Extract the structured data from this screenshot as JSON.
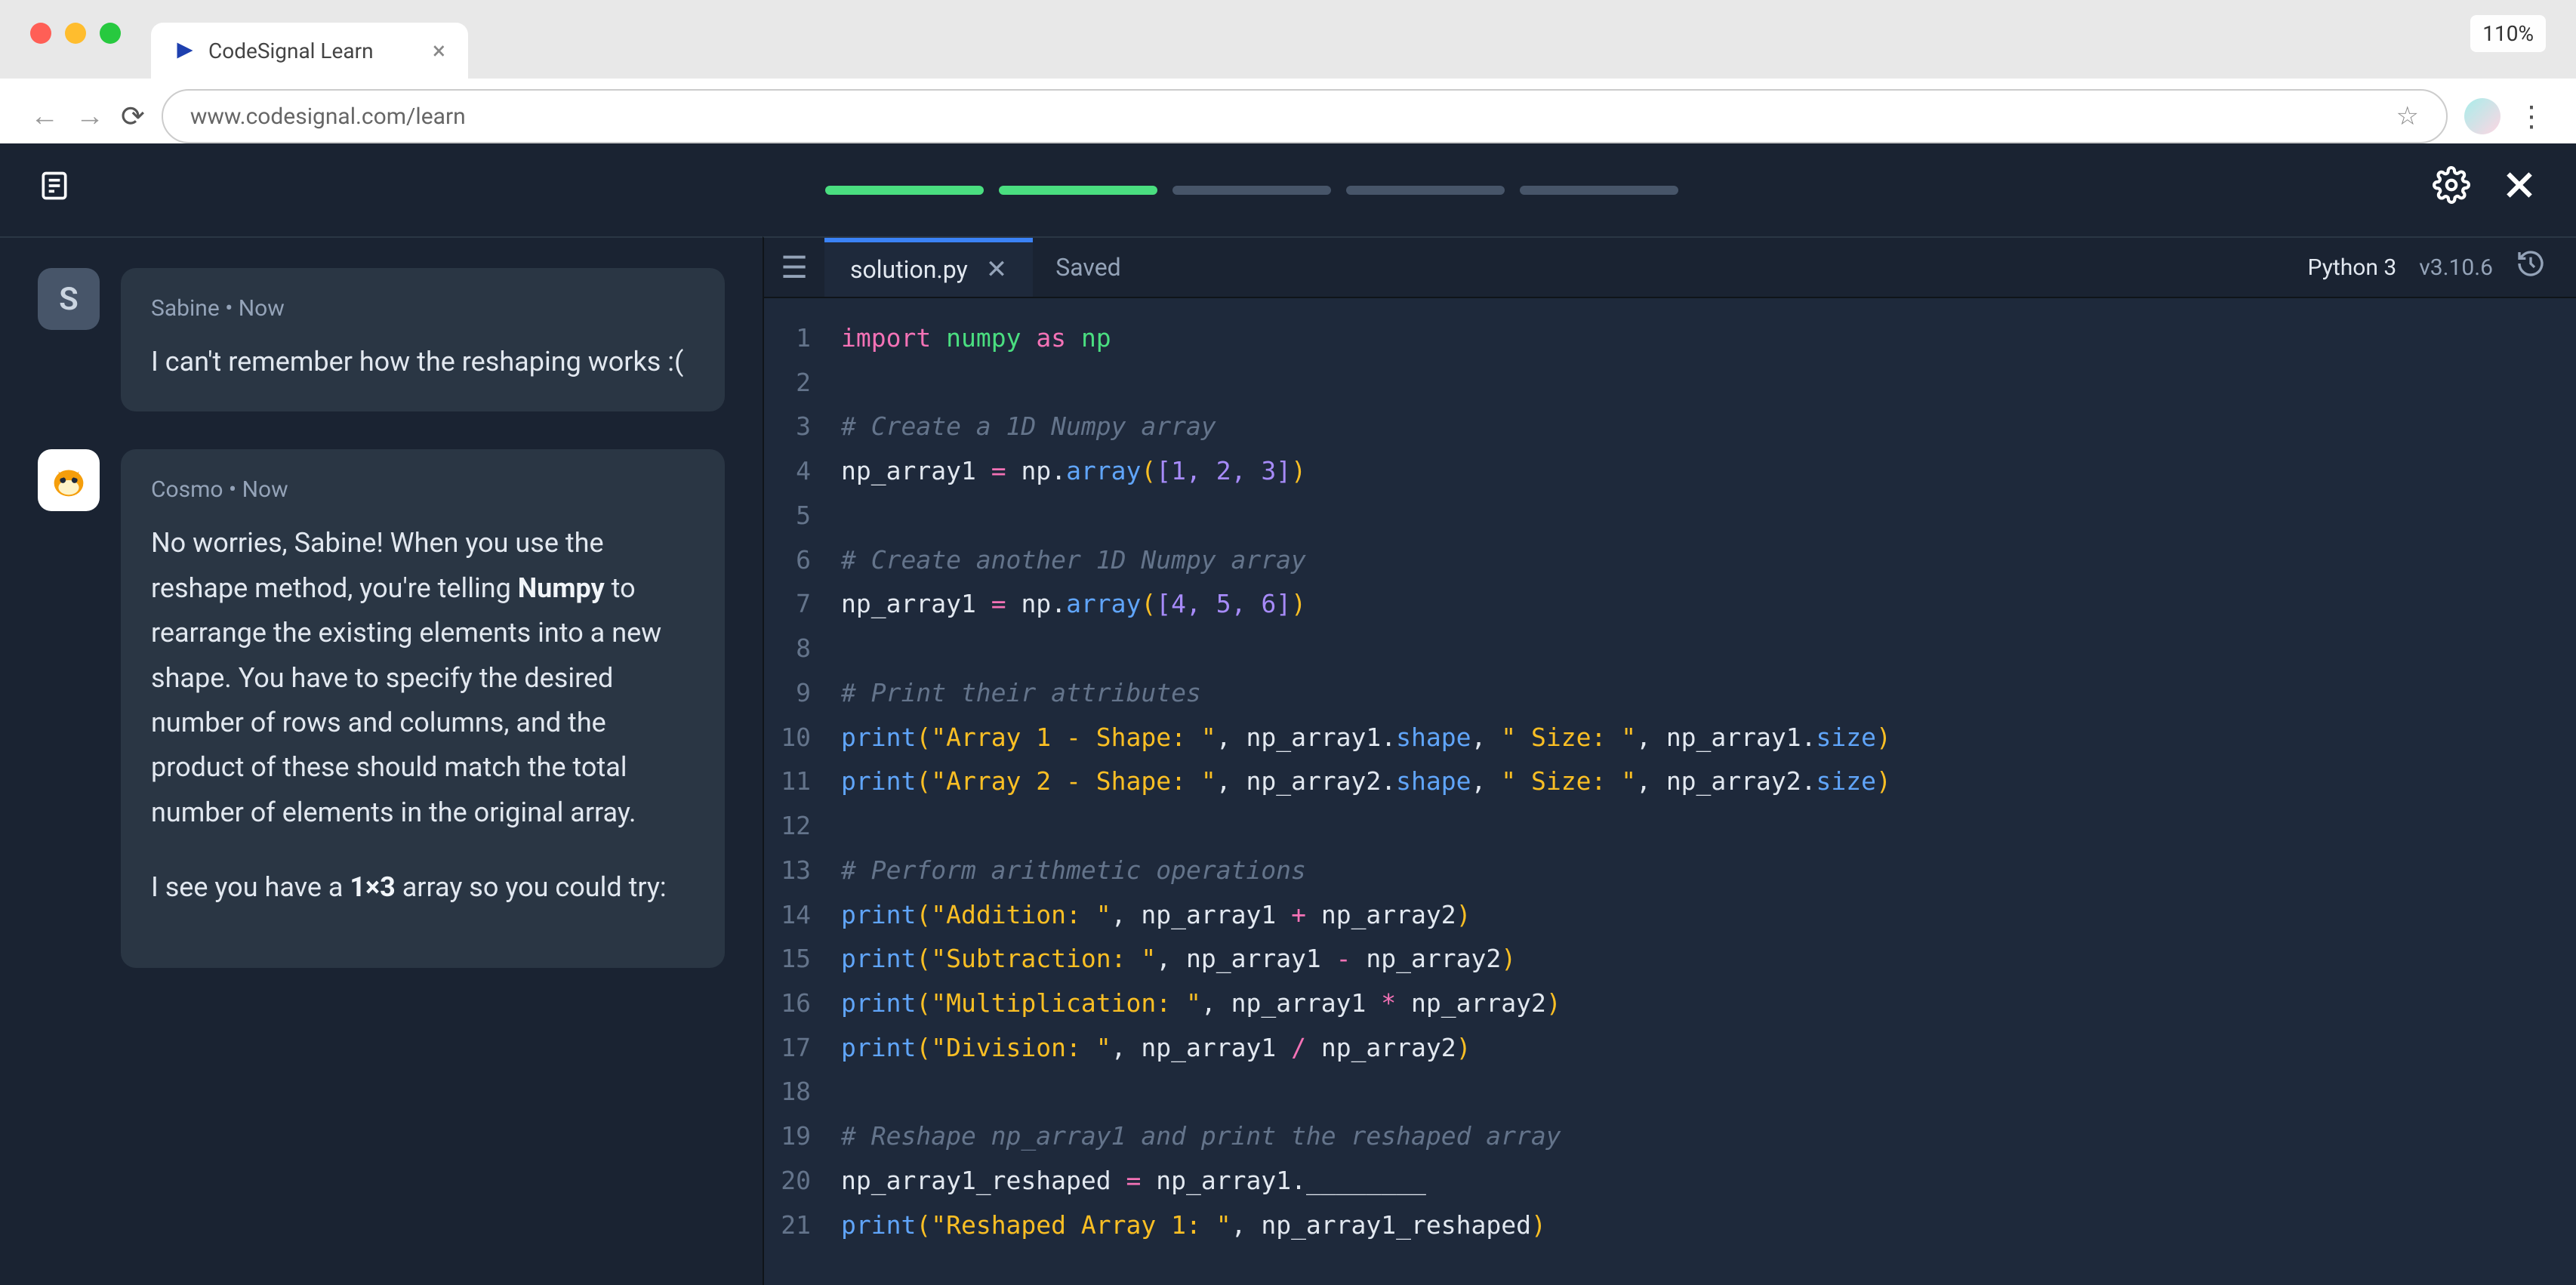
{
  "zoom": "110%",
  "browser": {
    "tab_title": "CodeSignal Learn",
    "url": "www.codesignal.com/learn"
  },
  "progress": {
    "done": 2,
    "total": 5
  },
  "chat": {
    "user": {
      "name": "Sabine",
      "initial": "S",
      "time": "Now",
      "message": "I can't remember how the reshaping works :("
    },
    "bot": {
      "name": "Cosmo",
      "time": "Now",
      "p1a": "No worries, Sabine! When you use the reshape method, you're telling ",
      "p1_bold": "Numpy",
      "p1b": " to rearrange the existing elements into a new shape. You have to specify the desired number of rows and columns, and the product of these should match the total number of elements in the original array.",
      "p2a": "I see you have a ",
      "p2_bold": "1×3",
      "p2b": " array so you could try:"
    }
  },
  "editor": {
    "filename": "solution.py",
    "saved": "Saved",
    "language": "Python 3",
    "version": "v3.10.6",
    "code": {
      "l1_import": "import",
      "l1_numpy": "numpy",
      "l1_as": "as",
      "l1_np": "np",
      "l3": "# Create a 1D Numpy array",
      "l4_var": "np_array1",
      "l4_eq": "=",
      "l4_np": "np",
      "l4_arr": "array",
      "l4_vals": "1, 2, 3",
      "l6": "# Create another 1D Numpy array",
      "l7_var": "np_array1",
      "l7_np": "np",
      "l7_arr": "array",
      "l7_vals": "4, 5, 6",
      "l9": "# Print their attributes",
      "l10_print": "print",
      "l10_s1": "\"Array 1 - Shape: \"",
      "l10_v1": "np_array1",
      "l10_shape": "shape",
      "l10_s2": "\" Size: \"",
      "l10_size": "size",
      "l11_print": "print",
      "l11_s1": "\"Array 2 - Shape: \"",
      "l11_v1": "np_array2",
      "l11_shape": "shape",
      "l11_s2": "\" Size: \"",
      "l11_size": "size",
      "l13": "# Perform arithmetic operations",
      "l14_print": "print",
      "l14_s": "\"Addition: \"",
      "l14_a": "np_array1",
      "l14_op": "+",
      "l14_b": "np_array2",
      "l15_print": "print",
      "l15_s": "\"Subtraction: \"",
      "l15_a": "np_array1",
      "l15_op": "-",
      "l15_b": "np_array2",
      "l16_print": "print",
      "l16_s": "\"Multiplication: \"",
      "l16_a": "np_array1",
      "l16_op": "*",
      "l16_b": "np_array2",
      "l17_print": "print",
      "l17_s": "\"Division: \"",
      "l17_a": "np_array1",
      "l17_op": "/",
      "l17_b": "np_array2",
      "l19": "# Reshape np_array1 and print the reshaped array",
      "l20_var": "np_array1_reshaped",
      "l20_src": "np_array1",
      "l20_blank": "________",
      "l21_print": "print",
      "l21_s": "\"Reshaped Array 1: \"",
      "l21_v": "np_array1_reshaped"
    }
  }
}
